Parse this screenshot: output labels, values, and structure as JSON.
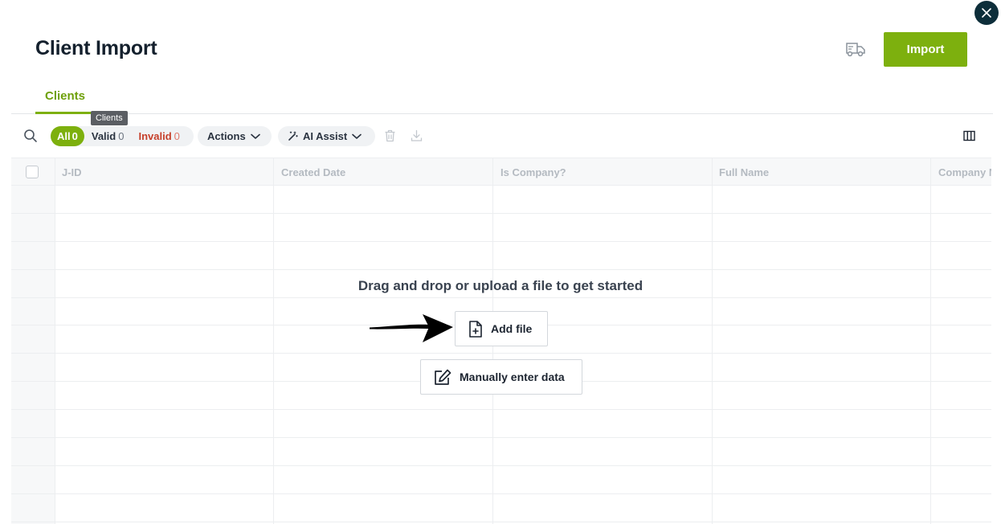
{
  "header": {
    "title": "Client Import",
    "import_label": "Import",
    "truck_icon": "truck-icon",
    "close_icon": "close-icon"
  },
  "tabs": [
    {
      "label": "Clients",
      "active": true
    }
  ],
  "tooltip": {
    "text": "Clients"
  },
  "toolbar": {
    "search_icon": "search-icon",
    "filters": [
      {
        "label": "All",
        "count": "0",
        "active": true
      },
      {
        "label": "Valid",
        "count": "0",
        "active": false
      },
      {
        "label": "Invalid",
        "count": "0",
        "active": false
      }
    ],
    "actions_label": "Actions",
    "ai_assist_label": "AI Assist",
    "trash_icon": "trash-icon",
    "download_icon": "download-icon",
    "columns_icon": "columns-icon"
  },
  "table": {
    "columns": [
      "J-ID",
      "Created Date",
      "Is Company?",
      "Full Name",
      "Company Name"
    ]
  },
  "empty_state": {
    "message": "Drag and drop or upload a file to get started",
    "add_file_label": "Add file",
    "manual_label": "Manually enter data"
  },
  "colors": {
    "accent": "#7db00e",
    "invalid": "#c6402b",
    "close_bg": "#0d2e3a"
  }
}
